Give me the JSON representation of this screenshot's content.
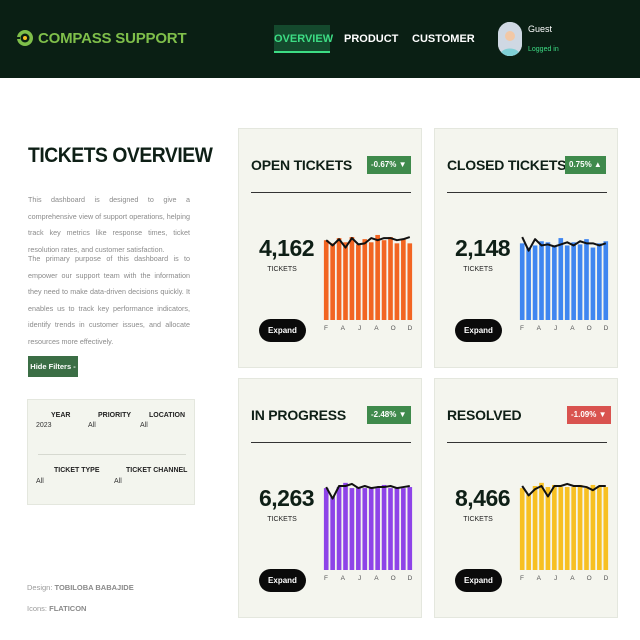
{
  "header": {
    "brand": "COMPASS SUPPORT",
    "nav": [
      "OVERVIEW",
      "PRODUCT",
      "CUSTOMER"
    ],
    "active_nav": "OVERVIEW",
    "user_name": "Guest",
    "user_status": "Logged in"
  },
  "left": {
    "title": "TICKETS OVERVIEW",
    "desc1": "This dashboard is designed to give a comprehensive view of support operations, helping track key metrics like response times, ticket resolution rates, and customer satisfaction.",
    "desc2": "The primary purpose of this dashboard is to empower our support team with the information they need to make data-driven decisions quickly. It enables us to track key performance indicators, identify trends in customer issues, and allocate resources more effectively.",
    "filter_button": "Hide Filters -",
    "filters": [
      {
        "label": "YEAR",
        "value": "2023"
      },
      {
        "label": "PRIORITY",
        "value": "All"
      },
      {
        "label": "LOCATION",
        "value": "All"
      },
      {
        "label": "TICKET TYPE",
        "value": "All"
      },
      {
        "label": "TICKET CHANNEL",
        "value": "All"
      }
    ],
    "credit_design_label": "Design:",
    "credit_design": "TOBILOBA BABAJIDE",
    "credit_icons_label": "Icons:",
    "credit_icons": "FLATICON"
  },
  "cards": [
    {
      "title": "OPEN TICKETS",
      "badge": "-0.67% ▼",
      "value": "4,162",
      "unit": "TICKETS",
      "expand": "Expand",
      "color": "#f26522",
      "badge_color": "#3f8a4c",
      "months": [
        "F",
        "A",
        "J",
        "A",
        "O",
        "D"
      ],
      "bars": [
        0.76,
        0.73,
        0.78,
        0.74,
        0.79,
        0.72,
        0.77,
        0.74,
        0.81,
        0.76,
        0.79,
        0.73,
        0.77,
        0.73
      ],
      "line": [
        0.76,
        0.71,
        0.77,
        0.69,
        0.78,
        0.72,
        0.73,
        0.78,
        0.76,
        0.78,
        0.78,
        0.76,
        0.77,
        0.79
      ]
    },
    {
      "title": "CLOSED TICKETS",
      "badge": "0.75% ▲",
      "value": "2,148",
      "unit": "TICKETS",
      "expand": "Expand",
      "color": "#3f86f0",
      "badge_color": "#3f8a4c",
      "months": [
        "F",
        "A",
        "J",
        "A",
        "O",
        "D"
      ],
      "bars": [
        0.73,
        0.69,
        0.71,
        0.75,
        0.74,
        0.7,
        0.78,
        0.71,
        0.74,
        0.72,
        0.77,
        0.69,
        0.73,
        0.75
      ],
      "line": [
        0.79,
        0.66,
        0.77,
        0.71,
        0.72,
        0.7,
        0.72,
        0.74,
        0.71,
        0.75,
        0.73,
        0.73,
        0.71,
        0.73
      ]
    },
    {
      "title": "IN PROGRESS",
      "badge": "-2.48% ▼",
      "value": "6,263",
      "unit": "TICKETS",
      "expand": "Expand",
      "color": "#8e44e8",
      "badge_color": "#3f8a4c",
      "months": [
        "F",
        "A",
        "J",
        "A",
        "O",
        "D"
      ],
      "bars": [
        0.78,
        0.7,
        0.79,
        0.83,
        0.78,
        0.79,
        0.78,
        0.79,
        0.78,
        0.81,
        0.78,
        0.79,
        0.78,
        0.79
      ],
      "line": [
        0.79,
        0.68,
        0.8,
        0.8,
        0.82,
        0.78,
        0.8,
        0.78,
        0.79,
        0.79,
        0.8,
        0.78,
        0.79,
        0.8
      ]
    },
    {
      "title": "RESOLVED",
      "badge": "-1.09% ▼",
      "value": "8,466",
      "unit": "TICKETS",
      "expand": "Expand",
      "color": "#f7c022",
      "badge_color": "#d9534f",
      "months": [
        "F",
        "A",
        "J",
        "A",
        "O",
        "D"
      ],
      "bars": [
        0.78,
        0.72,
        0.8,
        0.83,
        0.79,
        0.81,
        0.79,
        0.79,
        0.79,
        0.81,
        0.78,
        0.81,
        0.79,
        0.79
      ],
      "line": [
        0.8,
        0.71,
        0.77,
        0.8,
        0.7,
        0.8,
        0.8,
        0.82,
        0.8,
        0.8,
        0.79,
        0.76,
        0.8,
        0.8
      ]
    }
  ]
}
